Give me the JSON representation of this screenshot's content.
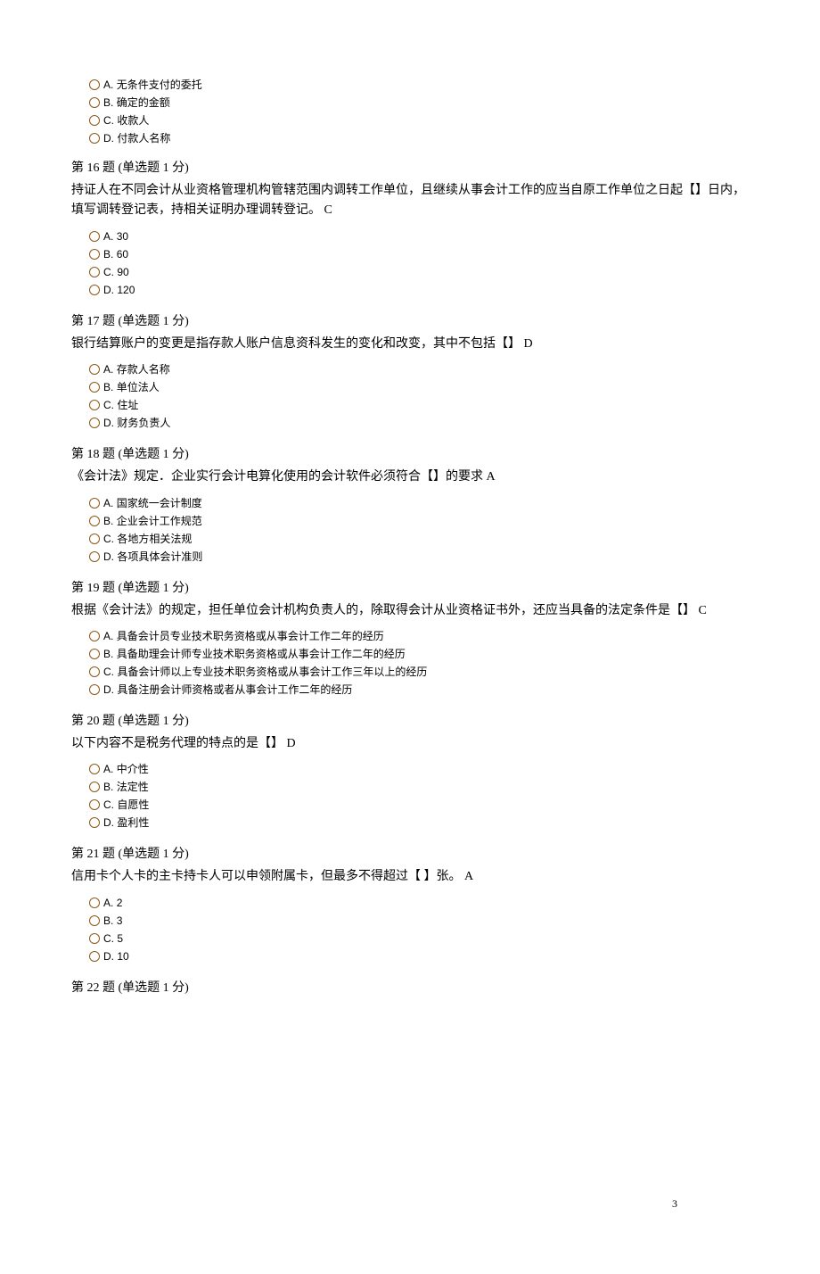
{
  "page_number": "3",
  "q15_partial": {
    "opts": [
      {
        "key": "A",
        "text": "无条件支付的委托"
      },
      {
        "key": "B",
        "text": "确定的金额"
      },
      {
        "key": "C",
        "text": "收款人"
      },
      {
        "key": "D",
        "text": "付款人名称"
      }
    ]
  },
  "questions": [
    {
      "num": "16",
      "type": "(单选题  1 分)",
      "text": "持证人在不同会计从业资格管理机构管辖范围内调转工作单位，且继续从事会计工作的应当自原工作单位之日起【】日内，填写调转登记表，持相关证明办理调转登记。  C",
      "opts": [
        {
          "key": "A",
          "text": "30"
        },
        {
          "key": "B",
          "text": "60"
        },
        {
          "key": "C",
          "text": "90"
        },
        {
          "key": "D",
          "text": "120"
        }
      ]
    },
    {
      "num": "17",
      "type": "(单选题  1 分)",
      "text": "银行结算账户的变更是指存款人账户信息资科发生的变化和改变，其中不包括【】   D",
      "opts": [
        {
          "key": "A",
          "text": "存款人名称"
        },
        {
          "key": "B",
          "text": "单位法人"
        },
        {
          "key": "C",
          "text": "住址"
        },
        {
          "key": "D",
          "text": "财务负责人"
        }
      ]
    },
    {
      "num": "18",
      "type": "(单选题  1 分)",
      "text": "《会计法》规定．企业实行会计电算化使用的会计软件必须符合【】的要求      A",
      "opts": [
        {
          "key": "A",
          "text": "国家统一会计制度"
        },
        {
          "key": "B",
          "text": "企业会计工作规范"
        },
        {
          "key": "C",
          "text": "各地方相关法规"
        },
        {
          "key": "D",
          "text": "各项具体会计准则"
        }
      ]
    },
    {
      "num": "19",
      "type": "(单选题  1 分)",
      "text": "根据《会计法》的规定，担任单位会计机构负责人的，除取得会计从业资格证书外，还应当具备的法定条件是【】   C",
      "opts": [
        {
          "key": "A",
          "text": "具备会计员专业技术职务资格或从事会计工作二年的经历"
        },
        {
          "key": "B",
          "text": "具备助理会计师专业技术职务资格或从事会计工作二年的经历"
        },
        {
          "key": "C",
          "text": "具备会计师以上专业技术职务资格或从事会计工作三年以上的经历"
        },
        {
          "key": "D",
          "text": "具备注册会计师资格或者从事会计工作二年的经历"
        }
      ]
    },
    {
      "num": "20",
      "type": "(单选题  1 分)",
      "text": "以下内容不是税务代理的特点的是【】    D",
      "opts": [
        {
          "key": "A",
          "text": "中介性"
        },
        {
          "key": "B",
          "text": "法定性"
        },
        {
          "key": "C",
          "text": "自愿性"
        },
        {
          "key": "D",
          "text": "盈利性"
        }
      ]
    },
    {
      "num": "21",
      "type": "(单选题  1 分)",
      "text": "信用卡个人卡的主卡持卡人可以申领附属卡，但最多不得超过【     】张。  A",
      "opts": [
        {
          "key": "A",
          "text": "2"
        },
        {
          "key": "B",
          "text": "3"
        },
        {
          "key": "C",
          "text": "5"
        },
        {
          "key": "D",
          "text": "10"
        }
      ]
    }
  ],
  "q22_header": {
    "num": "22",
    "type": "(单选题  1 分)"
  },
  "labels": {
    "question_prefix": "第",
    "question_suffix": "题"
  }
}
